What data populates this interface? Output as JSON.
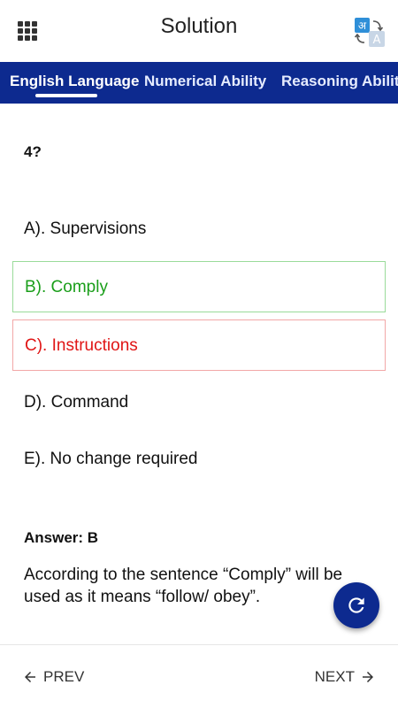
{
  "header": {
    "menu_icon": "grid-menu-icon",
    "title": "Solution",
    "translate_icon": "translate-icon",
    "translate_glyph_hi": "अ",
    "translate_glyph_en": "A"
  },
  "tabs": [
    {
      "label": "English Language",
      "active": true
    },
    {
      "label": "Numerical Ability",
      "active": false
    },
    {
      "label": "Reasoning Ability",
      "active": false
    }
  ],
  "question": {
    "number": "4?",
    "options": [
      {
        "label": "A). Supervisions",
        "state": "neutral"
      },
      {
        "label": "B). Comply",
        "state": "correct"
      },
      {
        "label": "C). Instructions",
        "state": "wrong"
      },
      {
        "label": "D). Command",
        "state": "neutral"
      },
      {
        "label": "E). No change required",
        "state": "neutral"
      }
    ],
    "answer": "Answer: B",
    "explanation": "According to the sentence “Comply” will be used as it means “follow/ obey”."
  },
  "fab": {
    "icon": "refresh-icon"
  },
  "footer": {
    "prev_label": "PREV",
    "next_label": "NEXT",
    "prev_icon": "arrow-left-icon",
    "next_icon": "arrow-right-icon"
  },
  "colors": {
    "brand": "#0d2a8f",
    "correct": "#1a9e1a",
    "wrong": "#e01515"
  }
}
